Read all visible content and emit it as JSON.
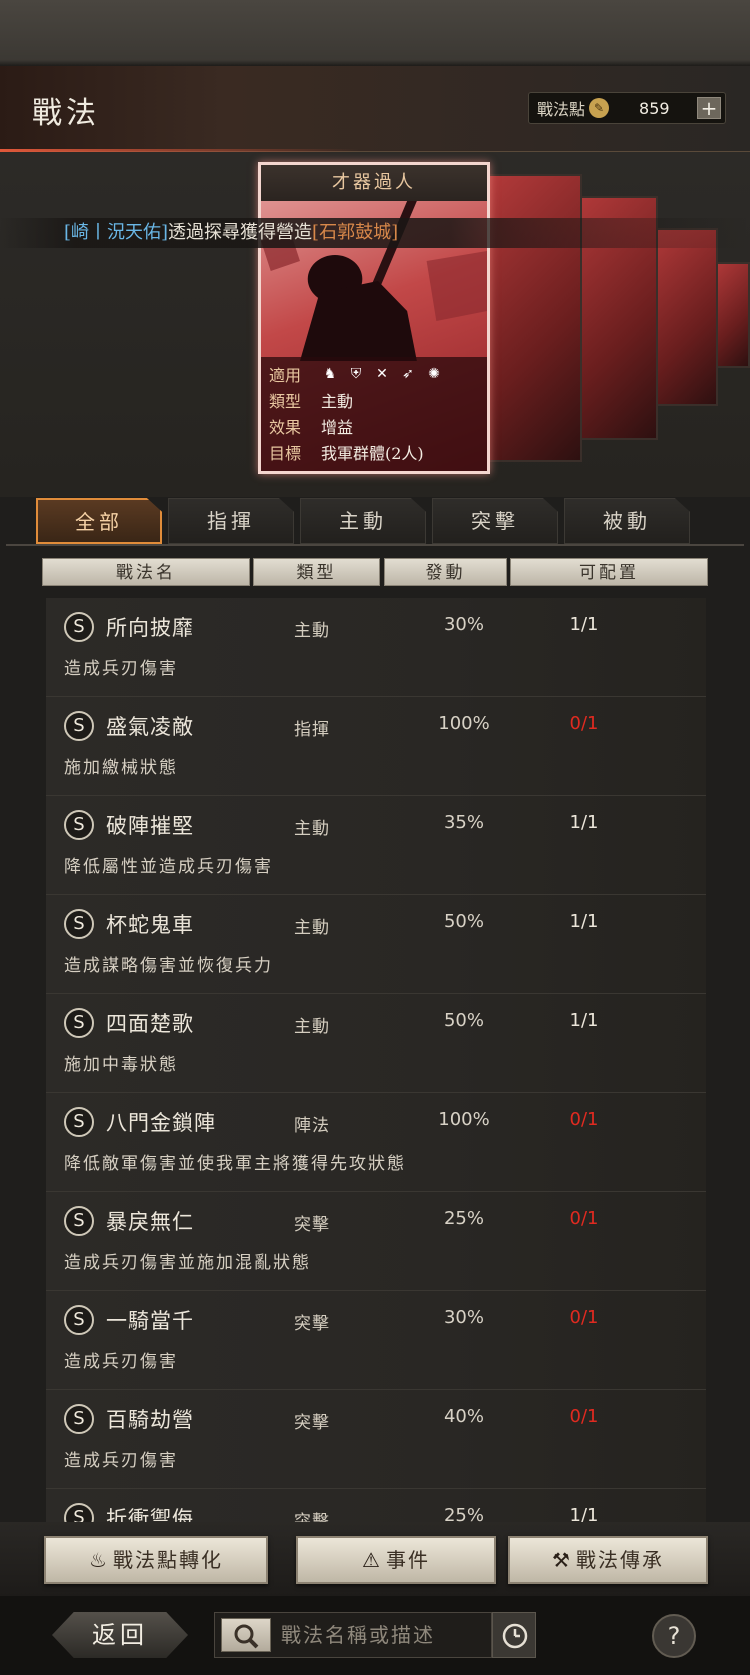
{
  "header": {
    "title": "戰法",
    "points_label": "戰法點",
    "points_value": "859",
    "plus_label": "+"
  },
  "card": {
    "name": "才器過人",
    "rows": [
      {
        "key": "適用",
        "value": ""
      },
      {
        "key": "類型",
        "value": "主動"
      },
      {
        "key": "效果",
        "value": "增益"
      },
      {
        "key": "目標",
        "value": "我軍群體(2人)"
      }
    ],
    "apply_icons": [
      "cavalry-icon",
      "shield-icon",
      "bow-icon",
      "spear-icon",
      "wheel-icon"
    ]
  },
  "ticker": {
    "player": "[崎丨況天佑]",
    "middle": "透過探尋獲得營造",
    "item": "[石郭鼓城]"
  },
  "tabs": [
    "全部",
    "指揮",
    "主動",
    "突擊",
    "被動"
  ],
  "active_tab": 0,
  "columns": [
    "戰法名",
    "類型",
    "發動",
    "可配置"
  ],
  "skills": [
    {
      "grade": "S",
      "name": "所向披靡",
      "type": "主動",
      "rate": "30%",
      "slots": "1/1",
      "slots_red": false,
      "desc": "造成兵刃傷害"
    },
    {
      "grade": "S",
      "name": "盛氣凌敵",
      "type": "指揮",
      "rate": "100%",
      "slots": "0/1",
      "slots_red": true,
      "desc": "施加繳械狀態"
    },
    {
      "grade": "S",
      "name": "破陣摧堅",
      "type": "主動",
      "rate": "35%",
      "slots": "1/1",
      "slots_red": false,
      "desc": "降低屬性並造成兵刃傷害"
    },
    {
      "grade": "S",
      "name": "杯蛇鬼車",
      "type": "主動",
      "rate": "50%",
      "slots": "1/1",
      "slots_red": false,
      "desc": "造成謀略傷害並恢復兵力"
    },
    {
      "grade": "S",
      "name": "四面楚歌",
      "type": "主動",
      "rate": "50%",
      "slots": "1/1",
      "slots_red": false,
      "desc": "施加中毒狀態"
    },
    {
      "grade": "S",
      "name": "八門金鎖陣",
      "type": "陣法",
      "rate": "100%",
      "slots": "0/1",
      "slots_red": true,
      "desc": "降低敵軍傷害並使我軍主將獲得先攻狀態"
    },
    {
      "grade": "S",
      "name": "暴戾無仁",
      "type": "突擊",
      "rate": "25%",
      "slots": "0/1",
      "slots_red": true,
      "desc": "造成兵刃傷害並施加混亂狀態"
    },
    {
      "grade": "S",
      "name": "一騎當千",
      "type": "突擊",
      "rate": "30%",
      "slots": "0/1",
      "slots_red": true,
      "desc": "造成兵刃傷害"
    },
    {
      "grade": "S",
      "name": "百騎劫營",
      "type": "突擊",
      "rate": "40%",
      "slots": "0/1",
      "slots_red": true,
      "desc": "造成兵刃傷害"
    },
    {
      "grade": "S",
      "name": "折衝禦侮",
      "type": "突擊",
      "rate": "25%",
      "slots": "1/1",
      "slots_red": false,
      "desc": ""
    }
  ],
  "buttons": {
    "convert": "戰法點轉化",
    "events": "事件",
    "inherit": "戰法傳承"
  },
  "footer": {
    "back": "返回",
    "search_placeholder": "戰法名稱或描述",
    "help": "?"
  }
}
